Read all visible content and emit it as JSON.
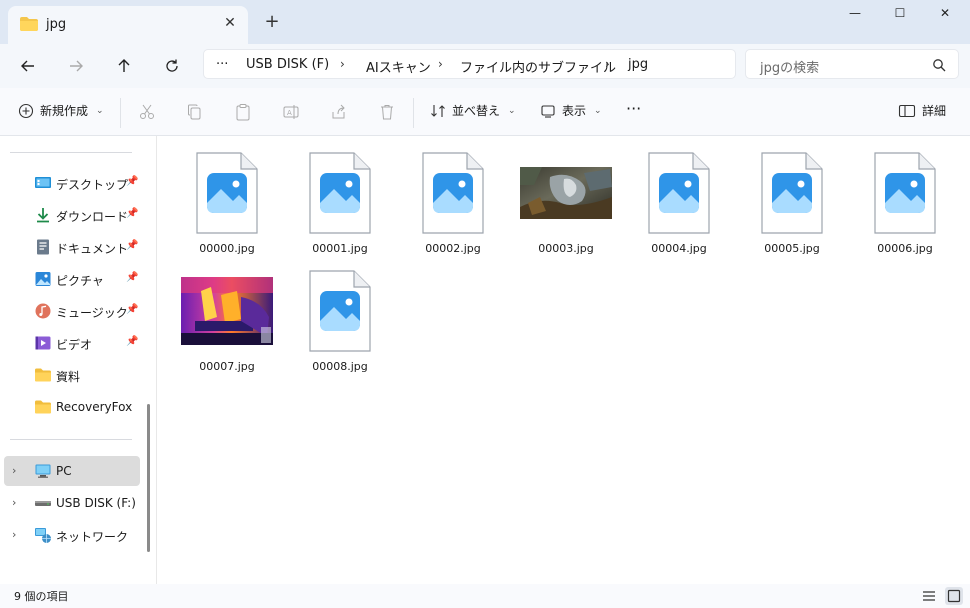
{
  "window": {
    "tab_title": "jpg",
    "tab_close": "✕",
    "new_tab": "+",
    "minimize": "—",
    "maximize": "☐",
    "close": "✕"
  },
  "address": {
    "more": "···",
    "crumbs": [
      "USB DISK (F)",
      "AIスキャン",
      "ファイル内のサブファイル",
      "jpg"
    ],
    "separator": "›",
    "search_placeholder": "jpgの検索"
  },
  "commands": {
    "new_label": "新規作成",
    "sort_label": "並べ替え",
    "view_label": "表示",
    "more_label": "···",
    "details_label": "詳細",
    "chevron": "⌄"
  },
  "sidebar": {
    "pinned": [
      {
        "label": "デスクトップ",
        "icon": "desktop-icon",
        "pin": "📌"
      },
      {
        "label": "ダウンロード",
        "icon": "download-icon",
        "pin": "📌"
      },
      {
        "label": "ドキュメント",
        "icon": "document-icon",
        "pin": "📌"
      },
      {
        "label": "ピクチャ",
        "icon": "pictures-icon",
        "pin": "📌"
      },
      {
        "label": "ミュージック",
        "icon": "music-icon",
        "pin": "📌"
      },
      {
        "label": "ビデオ",
        "icon": "video-icon",
        "pin": "📌"
      },
      {
        "label": "資料",
        "icon": "folder-icon"
      },
      {
        "label": "RecoveryFox",
        "icon": "folder-icon"
      }
    ],
    "devices": [
      {
        "label": "PC",
        "icon": "pc-icon",
        "expander": "›"
      },
      {
        "label": "USB DISK (F:)",
        "icon": "usb-drive-icon",
        "expander": "›"
      },
      {
        "label": "ネットワーク",
        "icon": "network-icon",
        "expander": "›"
      }
    ]
  },
  "files": [
    {
      "name": "00000.jpg",
      "thumb": "image-file-icon"
    },
    {
      "name": "00001.jpg",
      "thumb": "image-file-icon"
    },
    {
      "name": "00002.jpg",
      "thumb": "image-file-icon"
    },
    {
      "name": "00003.jpg",
      "thumb": "photo-thumbnail-dark"
    },
    {
      "name": "00004.jpg",
      "thumb": "image-file-icon"
    },
    {
      "name": "00005.jpg",
      "thumb": "image-file-icon"
    },
    {
      "name": "00006.jpg",
      "thumb": "image-file-icon"
    },
    {
      "name": "00007.jpg",
      "thumb": "thermal-photo-thumbnail"
    },
    {
      "name": "00008.jpg",
      "thumb": "image-file-icon"
    }
  ],
  "status": {
    "item_count": "9 個の項目"
  },
  "colors": {
    "titlebar": "#dfe8f4",
    "accent": "#0067c0",
    "selected": "#dcdcdc"
  }
}
